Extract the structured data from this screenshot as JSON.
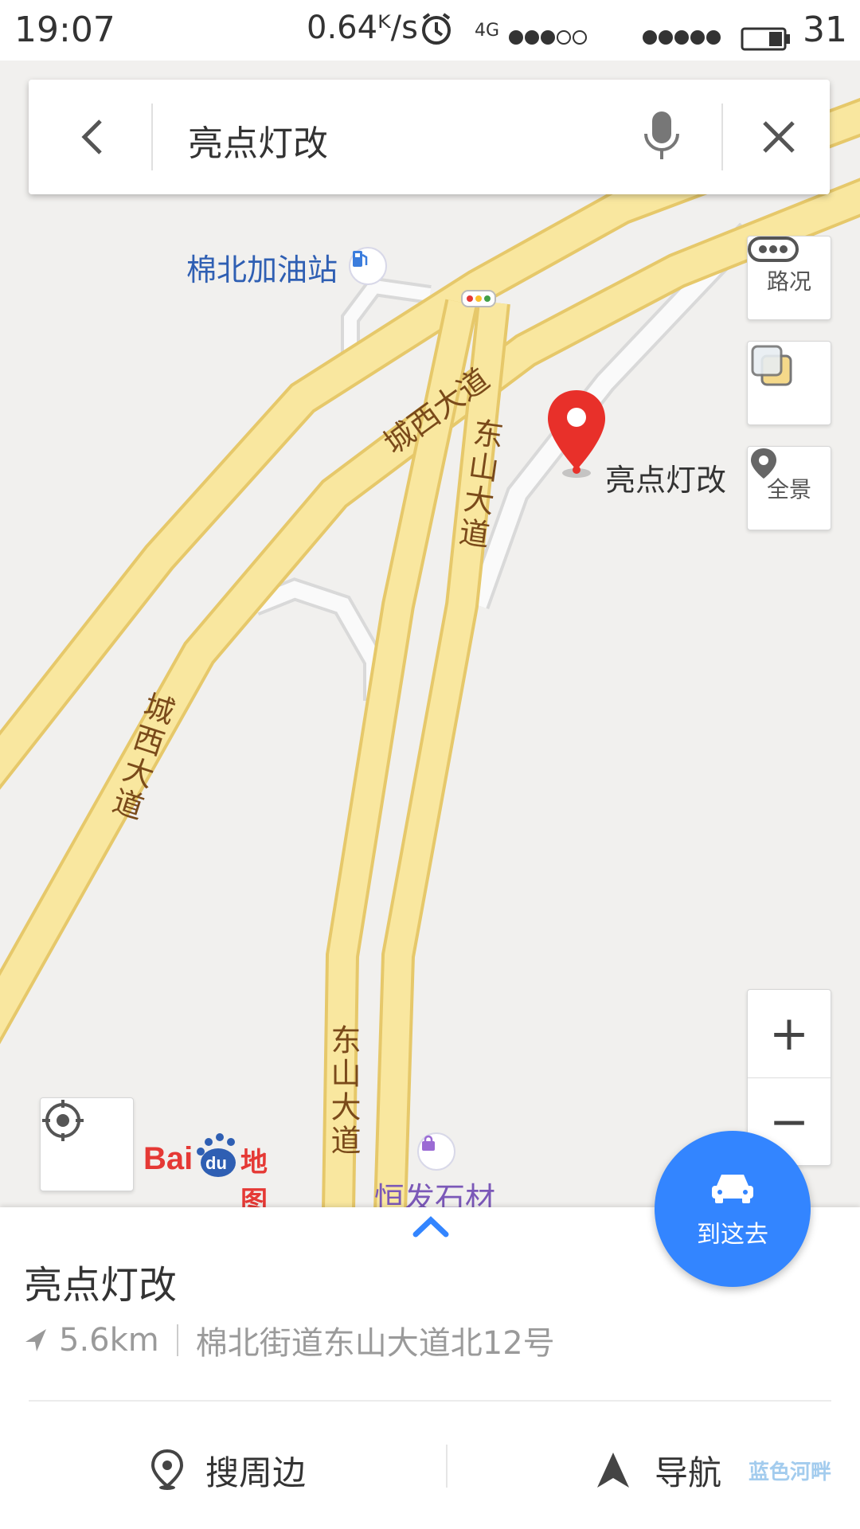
{
  "status_bar": {
    "time": "19:07",
    "speed": "0.64ᴷ/s",
    "network": "4G",
    "battery": "31"
  },
  "search": {
    "query": "亮点灯改"
  },
  "map": {
    "pois": {
      "gas_station": "棉北加油站",
      "destination": "亮点灯改",
      "shop": "恒发石材"
    },
    "roads": {
      "chengxi_upper": "城西大道",
      "chengxi_left": "城西大道",
      "dongshan_upper": "东山大道",
      "dongshan_lower": "东山大道"
    },
    "logo_text": "地图"
  },
  "tools": {
    "traffic": "路况",
    "panorama": "全景",
    "zoom_in": "+",
    "zoom_out": "−"
  },
  "place": {
    "name": "亮点灯改",
    "distance": "5.6km",
    "address": "棉北街道东山大道北12号"
  },
  "actions": {
    "nearby": "搜周边",
    "navigate": "导航",
    "go_here": "到这去"
  },
  "watermark": "蓝色河畔",
  "colors": {
    "accent": "#3385ff",
    "road_fill": "#f9e79f",
    "road_edge": "#e6c86a",
    "map_bg": "#f1f0ee",
    "pin": "#e8302a"
  }
}
